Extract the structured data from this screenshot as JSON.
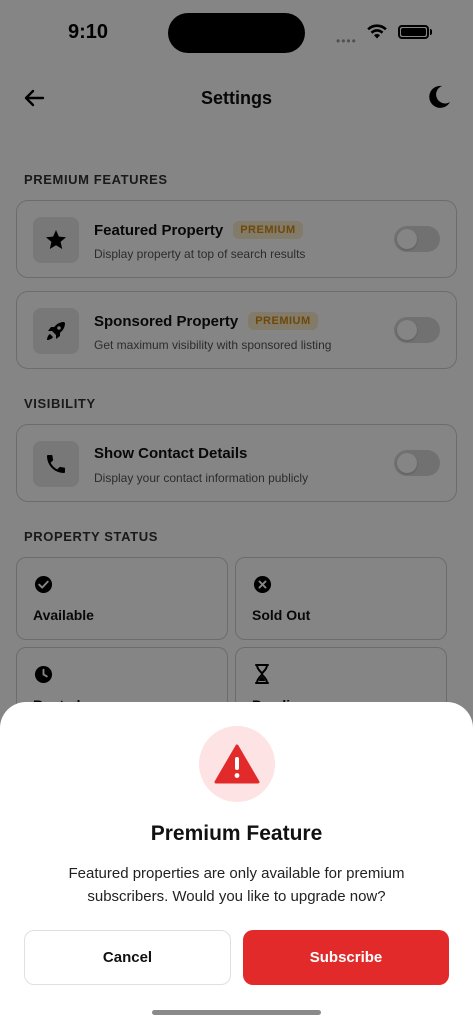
{
  "status_bar": {
    "time": "9:10",
    "signal": "••••"
  },
  "header": {
    "title": "Settings",
    "back_icon": "arrow-left-icon",
    "theme_icon": "moon-icon"
  },
  "sections": {
    "premium": "PREMIUM FEATURES",
    "visibility": "VISIBILITY",
    "status": "PROPERTY STATUS"
  },
  "settings": [
    {
      "title": "Featured Property",
      "badge": "PREMIUM",
      "subtitle": "Display property at top of search results",
      "icon": "star-icon",
      "enabled": false
    },
    {
      "title": "Sponsored Property",
      "badge": "PREMIUM",
      "subtitle": "Get maximum visibility with sponsored listing",
      "icon": "rocket-icon",
      "enabled": false
    },
    {
      "title": "Show Contact Details",
      "subtitle": "Display your contact information publicly",
      "icon": "phone-icon",
      "enabled": false
    }
  ],
  "property_status": [
    {
      "label": "Available",
      "icon": "check-circle-icon"
    },
    {
      "label": "Sold Out",
      "icon": "x-circle-icon"
    },
    {
      "label": "Rented",
      "icon": "clock-icon"
    },
    {
      "label": "Pending",
      "icon": "hourglass-icon"
    }
  ],
  "modal": {
    "icon": "warning-icon",
    "title": "Premium Feature",
    "message": "Featured properties are only available for premium subscribers. Would you like to upgrade now?",
    "cancel_label": "Cancel",
    "subscribe_label": "Subscribe"
  },
  "colors": {
    "accent": "#e32a2a",
    "badge_text": "#d18a12",
    "badge_bg": "#fbeccb",
    "warn_bg": "#fde3e3"
  }
}
